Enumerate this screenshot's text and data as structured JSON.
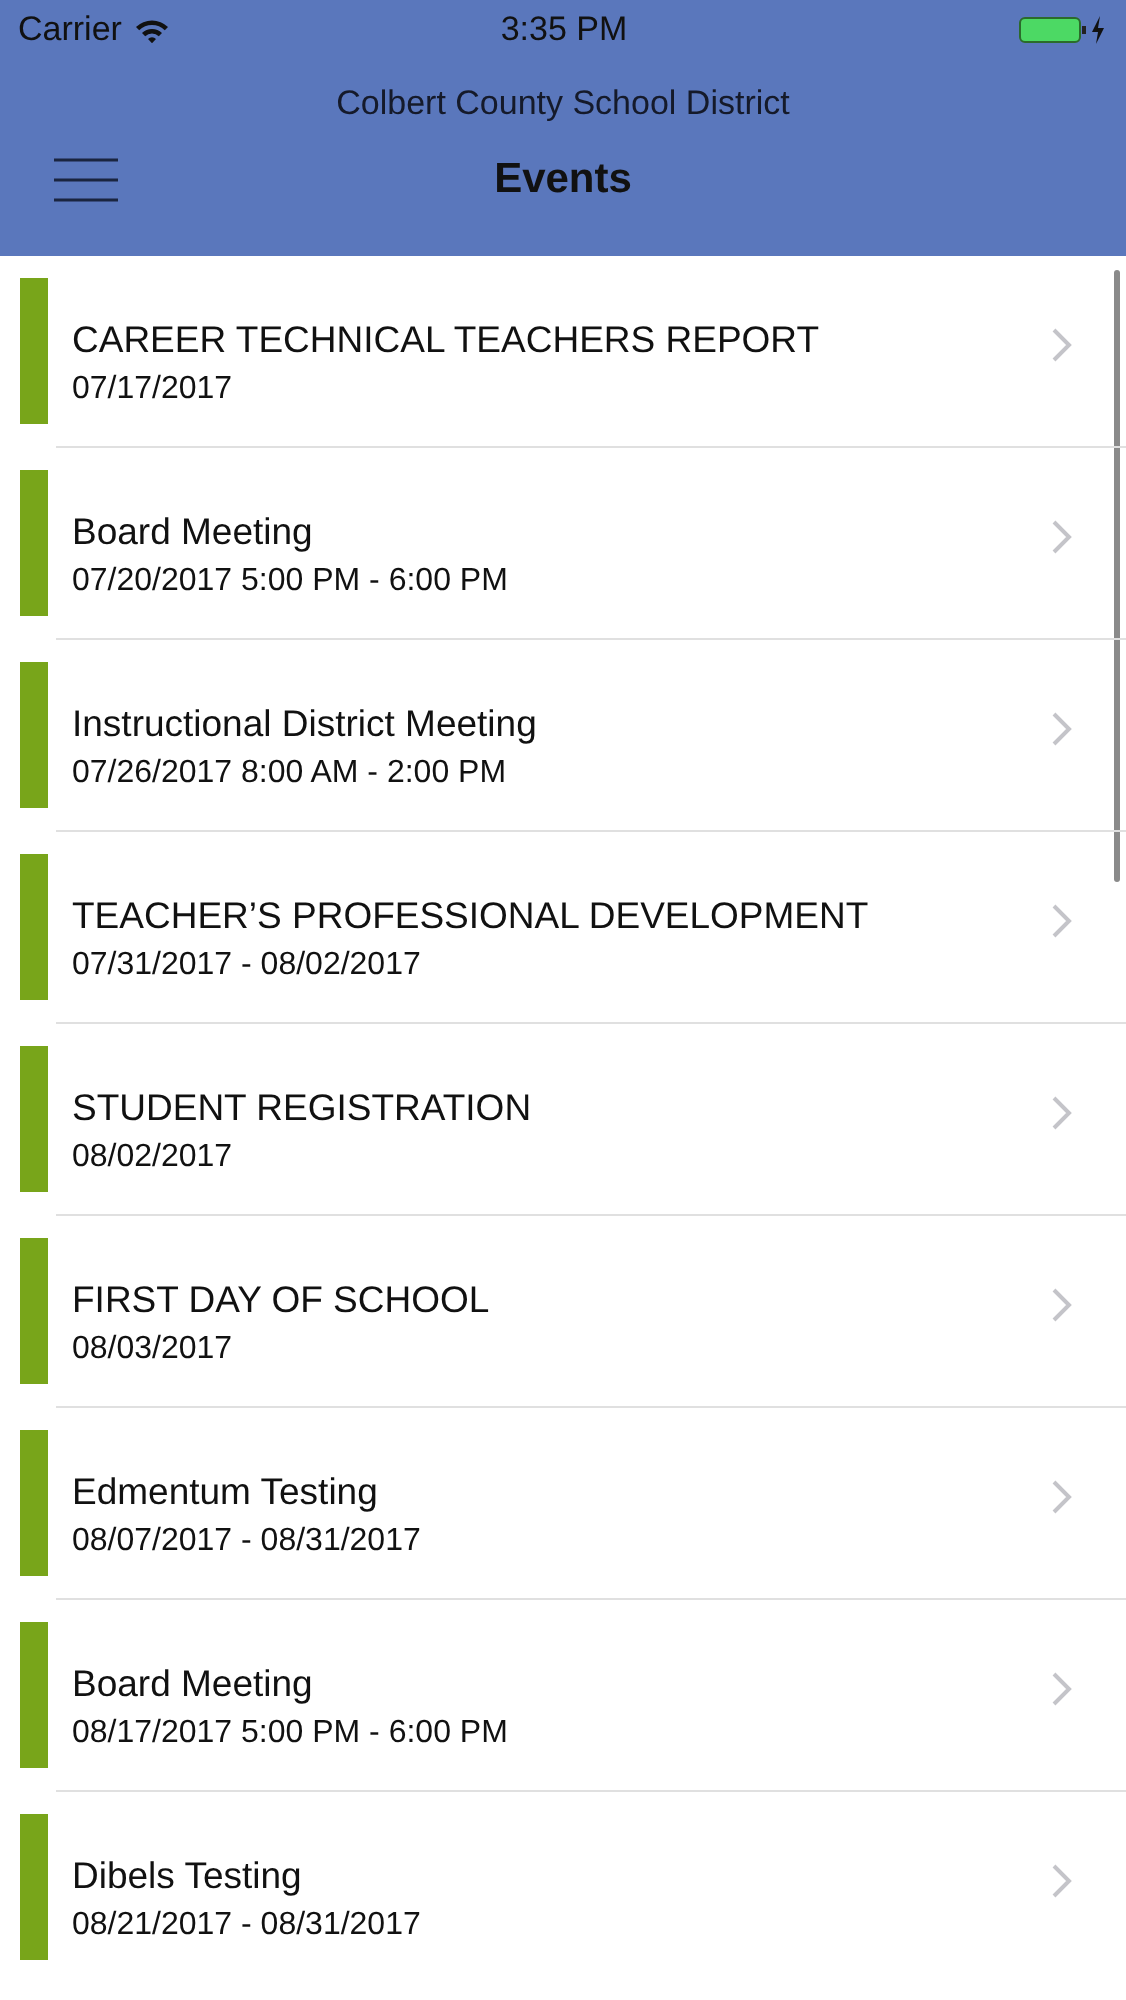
{
  "status_bar": {
    "carrier": "Carrier",
    "time": "3:35 PM"
  },
  "header": {
    "subtitle": "Colbert County School District",
    "title": "Events"
  },
  "events": [
    {
      "title": "CAREER TECHNICAL TEACHERS REPORT",
      "date": "07/17/2017"
    },
    {
      "title": "Board Meeting",
      "date": "07/20/2017 5:00 PM - 6:00 PM"
    },
    {
      "title": "Instructional District Meeting",
      "date": "07/26/2017 8:00 AM - 2:00 PM"
    },
    {
      "title": "TEACHER’S PROFESSIONAL DEVELOPMENT",
      "date": "07/31/2017 - 08/02/2017"
    },
    {
      "title": "STUDENT REGISTRATION",
      "date": "08/02/2017"
    },
    {
      "title": "FIRST DAY OF SCHOOL",
      "date": "08/03/2017"
    },
    {
      "title": "Edmentum Testing",
      "date": "08/07/2017 - 08/31/2017"
    },
    {
      "title": "Board Meeting",
      "date": "08/17/2017 5:00 PM - 6:00 PM"
    },
    {
      "title": "Dibels Testing",
      "date": "08/21/2017 - 08/31/2017"
    }
  ]
}
